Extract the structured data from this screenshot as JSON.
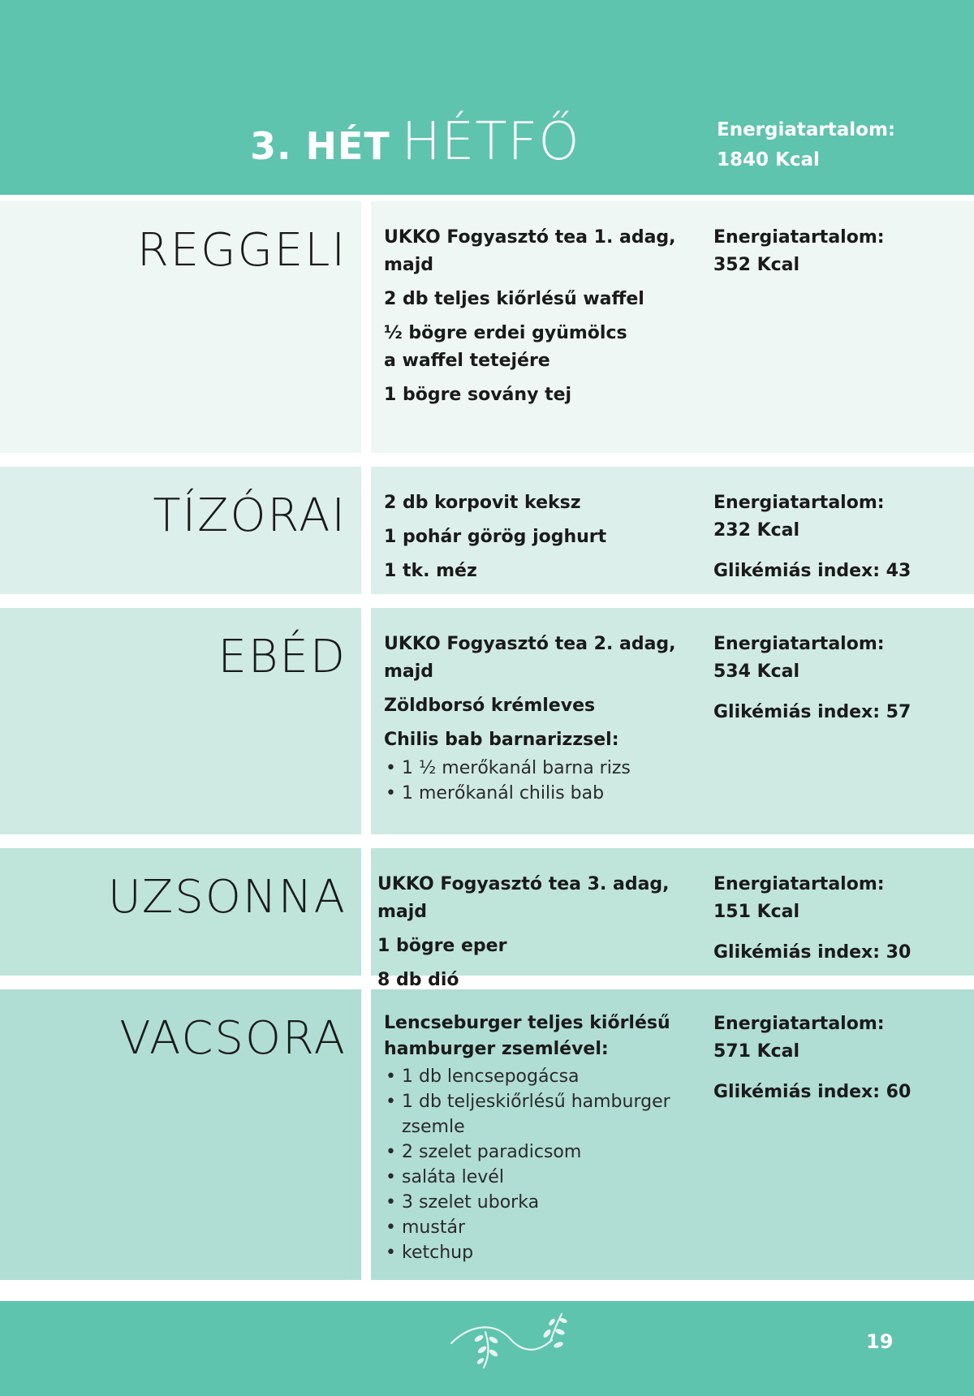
{
  "header": {
    "week": "3. HÉT",
    "day": "HÉTFŐ",
    "energy_label": "Energiatartalom:",
    "energy_value": "1840 Kcal"
  },
  "colors": {
    "accent": "#5ec4ae",
    "row1": "#eef7f4",
    "row2": "#dcefea",
    "row3": "#cfeae3",
    "row4": "#bfe4da",
    "row5": "#b0ded4"
  },
  "meals": [
    {
      "name": "REGGELI",
      "items": [
        "UKKO Fogyasztó tea 1. adag, majd",
        "2 db teljes kiőrlésű waffel",
        "½ bögre erdei gyümölcs\na waffel tetejére",
        "1 bögre sovány tej"
      ],
      "energy_label": "Energiatartalom:",
      "energy_value": "352 Kcal"
    },
    {
      "name": "TÍZÓRAI",
      "items": [
        "2 db korpovit keksz",
        "1 pohár görög joghurt",
        "1 tk. méz"
      ],
      "energy_label": "Energiatartalom:",
      "energy_value": "232 Kcal",
      "gi": "Glikémiás index: 43"
    },
    {
      "name": "EBÉD",
      "items": [
        "UKKO Fogyasztó tea 2. adag, majd",
        "Zöldborsó krémleves",
        "Chilis bab barnarizzsel:"
      ],
      "bullets": [
        "1 ½ merőkanál barna rizs",
        "1 merőkanál chilis bab"
      ],
      "energy_label": "Energiatartalom:",
      "energy_value": "534 Kcal",
      "gi": "Glikémiás index: 57"
    },
    {
      "name": "UZSONNA",
      "items": [
        "UKKO Fogyasztó tea 3. adag, majd",
        "1 bögre eper",
        "8 db dió"
      ],
      "energy_label": "Energiatartalom:",
      "energy_value": "151 Kcal",
      "gi": "Glikémiás index: 30"
    },
    {
      "name": "VACSORA",
      "items": [
        "Lencseburger teljes kiőrlésű\nhamburger zsemlével:"
      ],
      "bullets": [
        "1 db lencsepogácsa",
        "1 db teljeskiőrlésű hamburger\nzsemle",
        "2 szelet paradicsom",
        "saláta levél",
        "3 szelet uborka",
        "mustár",
        "ketchup"
      ],
      "energy_label": "Energiatartalom:",
      "energy_value": "571 Kcal",
      "gi": "Glikémiás index: 60"
    }
  ],
  "footer": {
    "page_number": "19",
    "ornament": "leaf-vine-icon"
  }
}
